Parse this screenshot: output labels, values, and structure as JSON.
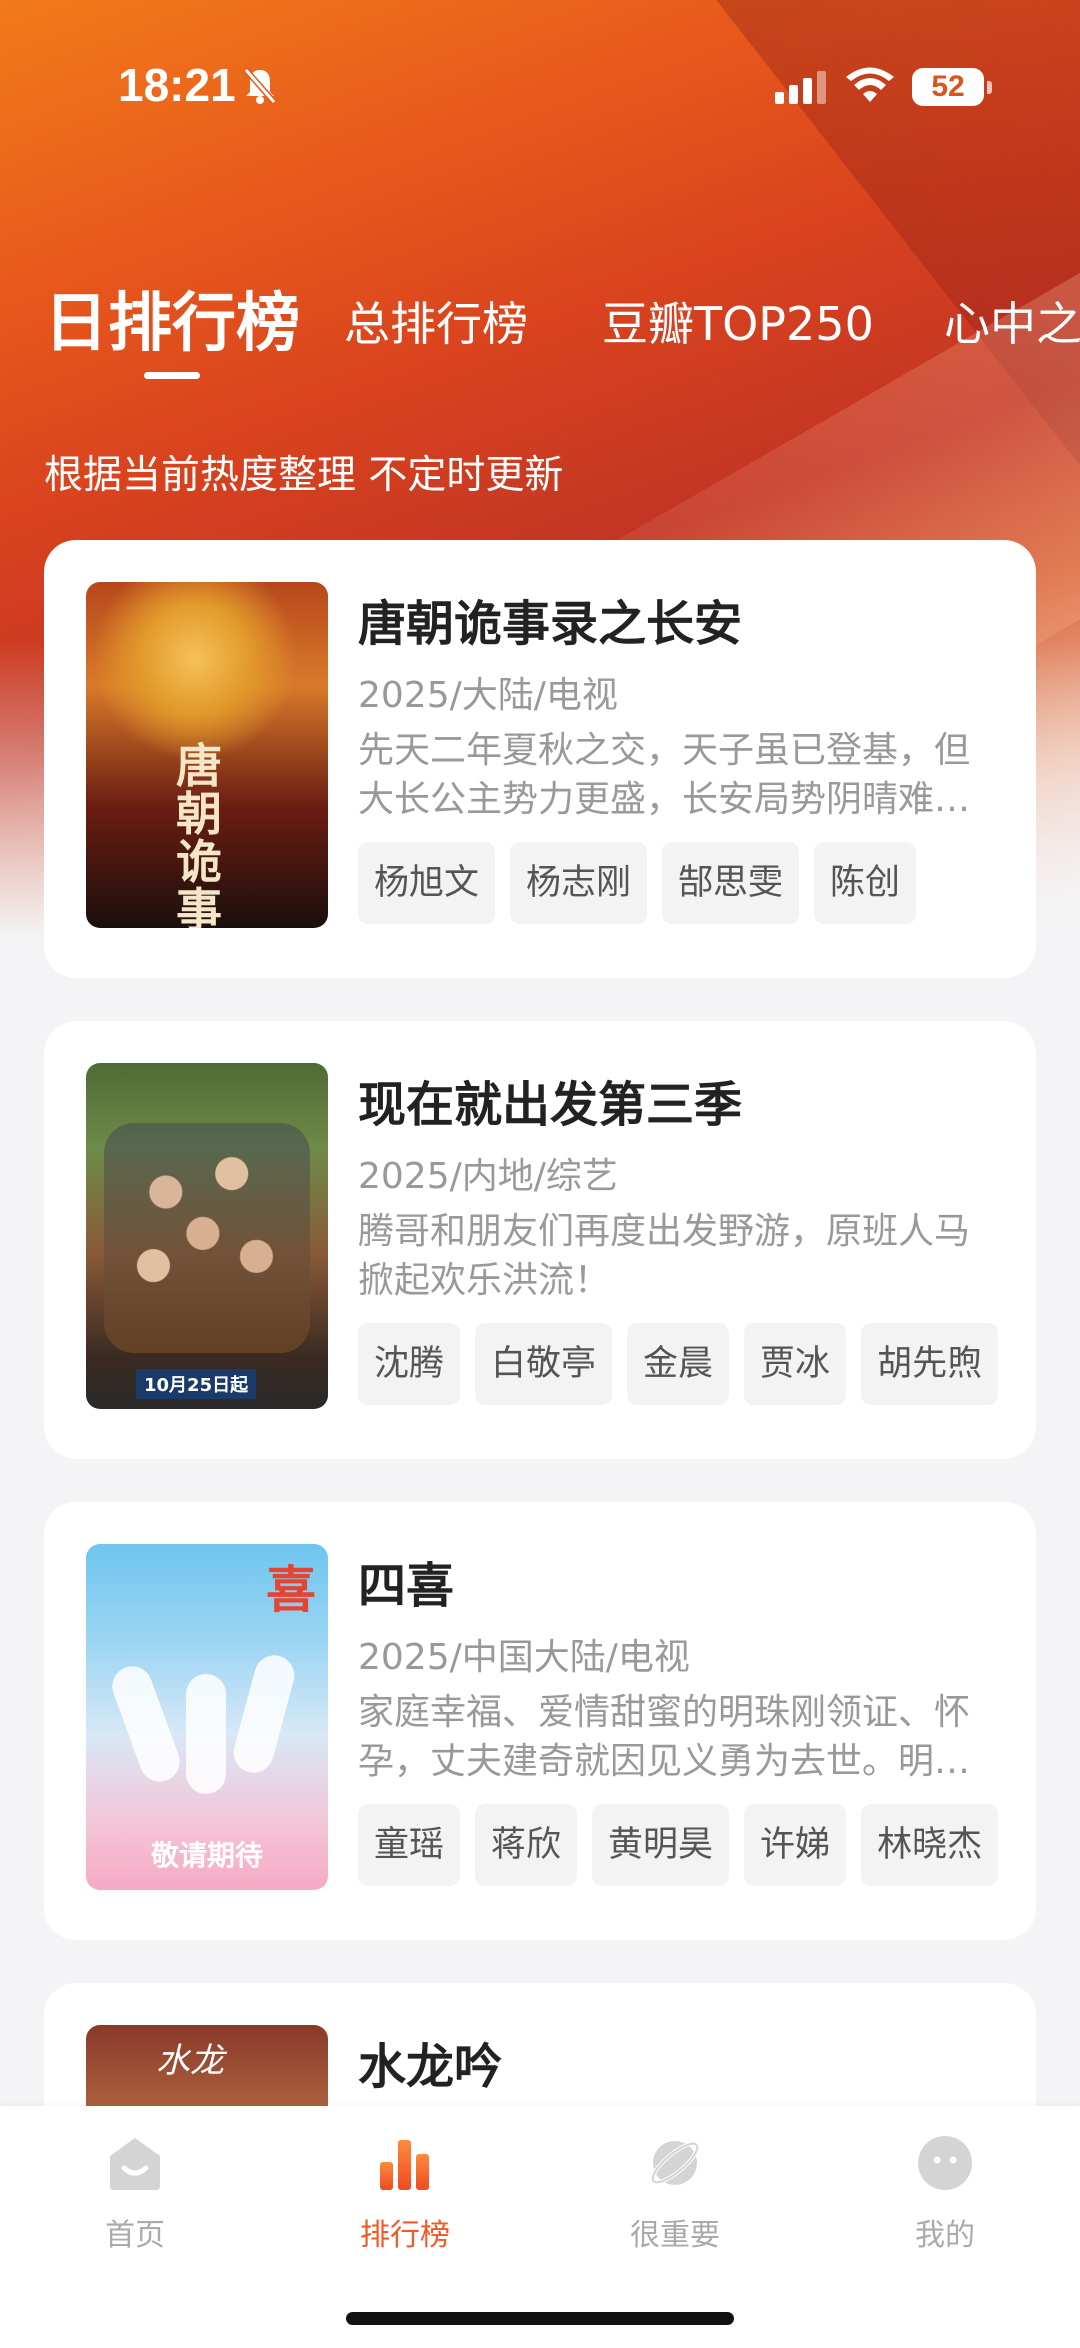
{
  "status_bar": {
    "time": "18:21",
    "battery": "52"
  },
  "tabs": [
    {
      "label": "日排行榜",
      "active": true
    },
    {
      "label": "总排行榜"
    },
    {
      "label": "豆瓣TOP250"
    },
    {
      "label": "心中之"
    }
  ],
  "subtitle": "根据当前热度整理 不定时更新",
  "items": [
    {
      "title": "唐朝诡事录之长安",
      "meta": "2025/大陆/电视",
      "desc": "先天二年夏秋之交，天子虽已登基，但大长公主势力更盛，长安局势阴晴难定。…",
      "tags": [
        "杨旭文",
        "杨志刚",
        "郜思雯",
        "陈创"
      ],
      "poster_text": "唐朝诡事录"
    },
    {
      "title": "现在就出发第三季",
      "meta": "2025/内地/综艺",
      "desc": "腾哥和朋友们再度出发野游，原班人马掀起欢乐洪流！",
      "tags": [
        "沈腾",
        "白敬亭",
        "金晨",
        "贾冰",
        "胡先煦"
      ],
      "poster_text": "10月25日起"
    },
    {
      "title": "四喜",
      "meta": "2025/中国大陆/电视",
      "desc": "家庭幸福、爱情甜蜜的明珠刚领证、怀孕，丈夫建奇就因见义勇为去世。明珠…",
      "tags": [
        "童瑶",
        "蒋欣",
        "黄明昊",
        "许娣",
        "林晓杰"
      ],
      "poster_text": "敬请期待",
      "poster_mark": "喜"
    },
    {
      "title": "水龙吟",
      "poster_text": "水龙"
    }
  ],
  "bottom_nav": [
    {
      "label": "首页",
      "icon": "home-icon"
    },
    {
      "label": "排行榜",
      "icon": "ranking-icon",
      "active": true
    },
    {
      "label": "很重要",
      "icon": "planet-icon"
    },
    {
      "label": "我的",
      "icon": "profile-icon"
    }
  ],
  "colors": {
    "accent": "#f05a24",
    "hero_top": "#f27a1a",
    "hero_mid": "#c23424"
  }
}
